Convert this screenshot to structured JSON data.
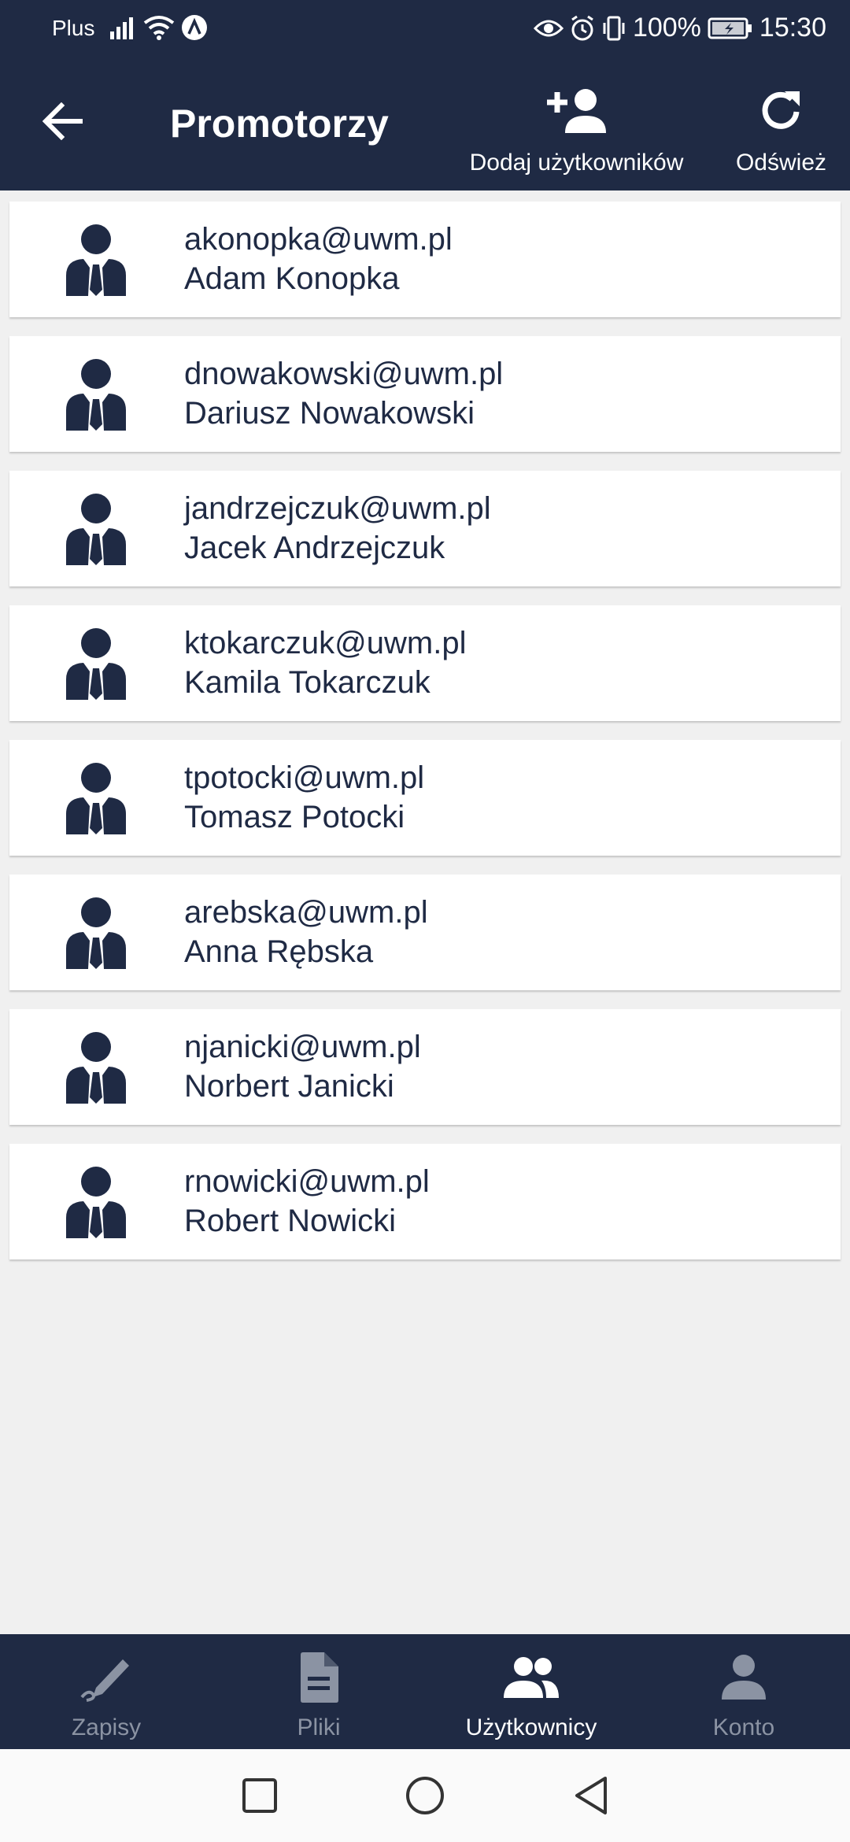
{
  "status_bar": {
    "carrier": "Plus",
    "battery": "100%",
    "time": "15:30"
  },
  "app_bar": {
    "title": "Promotorzy",
    "add_users_label": "Dodaj użytkowników",
    "refresh_label": "Odśwież"
  },
  "users": [
    {
      "email": "akonopka@uwm.pl",
      "name": "Adam Konopka"
    },
    {
      "email": "dnowakowski@uwm.pl",
      "name": "Dariusz Nowakowski"
    },
    {
      "email": "jandrzejczuk@uwm.pl",
      "name": "Jacek Andrzejczuk"
    },
    {
      "email": "ktokarczuk@uwm.pl",
      "name": "Kamila Tokarczuk"
    },
    {
      "email": "tpotocki@uwm.pl",
      "name": "Tomasz Potocki"
    },
    {
      "email": "arebska@uwm.pl",
      "name": "Anna Rębska"
    },
    {
      "email": "njanicki@uwm.pl",
      "name": "Norbert Janicki"
    },
    {
      "email": "rnowicki@uwm.pl",
      "name": "Robert Nowicki"
    }
  ],
  "bottom_nav": {
    "items": [
      {
        "label": "Zapisy",
        "icon": "pen-icon"
      },
      {
        "label": "Pliki",
        "icon": "document-icon"
      },
      {
        "label": "Użytkownicy",
        "icon": "people-icon"
      },
      {
        "label": "Konto",
        "icon": "person-icon"
      }
    ],
    "active": "Użytkownicy"
  },
  "colors": {
    "primary": "#1f2a44",
    "background": "#f0f0f0",
    "card": "#ffffff",
    "inactive_nav": "#8b93a3"
  }
}
